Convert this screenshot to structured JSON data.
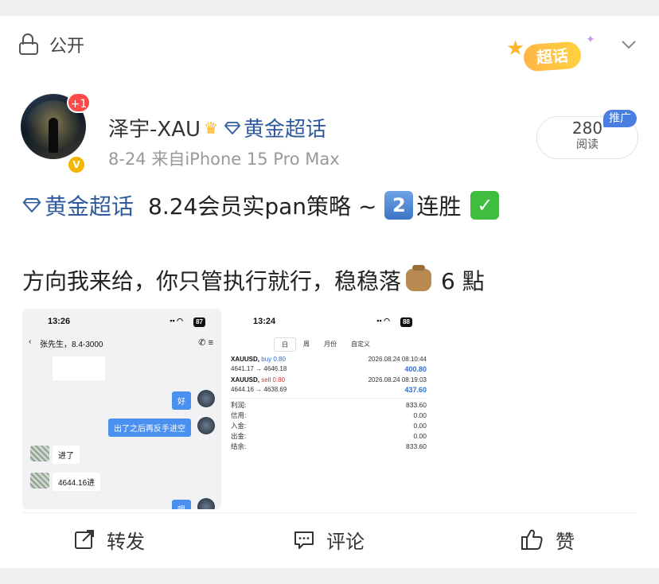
{
  "post": {
    "visibility_label": "公开",
    "supertalk_badge": "超话",
    "author": {
      "name": "泽宇-XAU",
      "topic": "黄金超话",
      "follow_badge": "+1",
      "verified_mark": "V"
    },
    "meta": "8-24  来自iPhone 15 Pro Max",
    "reads": {
      "count": "280",
      "label": "阅读",
      "promo_tag": "推广"
    },
    "body": {
      "topic": "黄金超话",
      "line1_text": "8.24会员实pan策略 ~",
      "keycap_number": "2",
      "line1_suffix": "连胜",
      "line2_text": "方向我来给，你只管执行就行，稳稳落",
      "line2_suffix": "6 點"
    }
  },
  "image1": {
    "status_time": "13:26",
    "battery": "87",
    "chat_title": "张先生，8.4-3000",
    "messages": [
      {
        "side": "right",
        "text": "好"
      },
      {
        "side": "right",
        "text": "出了之后再反手进空"
      },
      {
        "side": "left",
        "text": "进了"
      },
      {
        "side": "left",
        "text": "4644.16进"
      },
      {
        "side": "right",
        "text": "嗯"
      }
    ]
  },
  "image2": {
    "status_time": "13:24",
    "battery": "88",
    "tabs": [
      "日",
      "周",
      "月份",
      "自定义"
    ],
    "trades": [
      {
        "symbol": "XAUUSD,",
        "side": "buy 0.80",
        "time": "2026.08.24 08:10:44",
        "prices": "4641.17 → 4646.18",
        "profit": "400.80"
      },
      {
        "symbol": "XAUUSD,",
        "side": "sell 0.80",
        "time": "2026.08.24 08:19:03",
        "prices": "4644.16 → 4638.69",
        "profit": "437.60"
      }
    ],
    "summary": [
      {
        "label": "利润:",
        "value": "833.60"
      },
      {
        "label": "信用:",
        "value": "0.00"
      },
      {
        "label": "入金:",
        "value": "0.00"
      },
      {
        "label": "出金:",
        "value": "0.00"
      },
      {
        "label": "结余:",
        "value": "833.60"
      }
    ]
  },
  "actions": {
    "repost": "转发",
    "comment": "评论",
    "like": "赞"
  },
  "colors": {
    "topic_blue": "#2f5a9e",
    "accent_blue": "#4a90f0",
    "badge_red": "#ff4a4a"
  }
}
